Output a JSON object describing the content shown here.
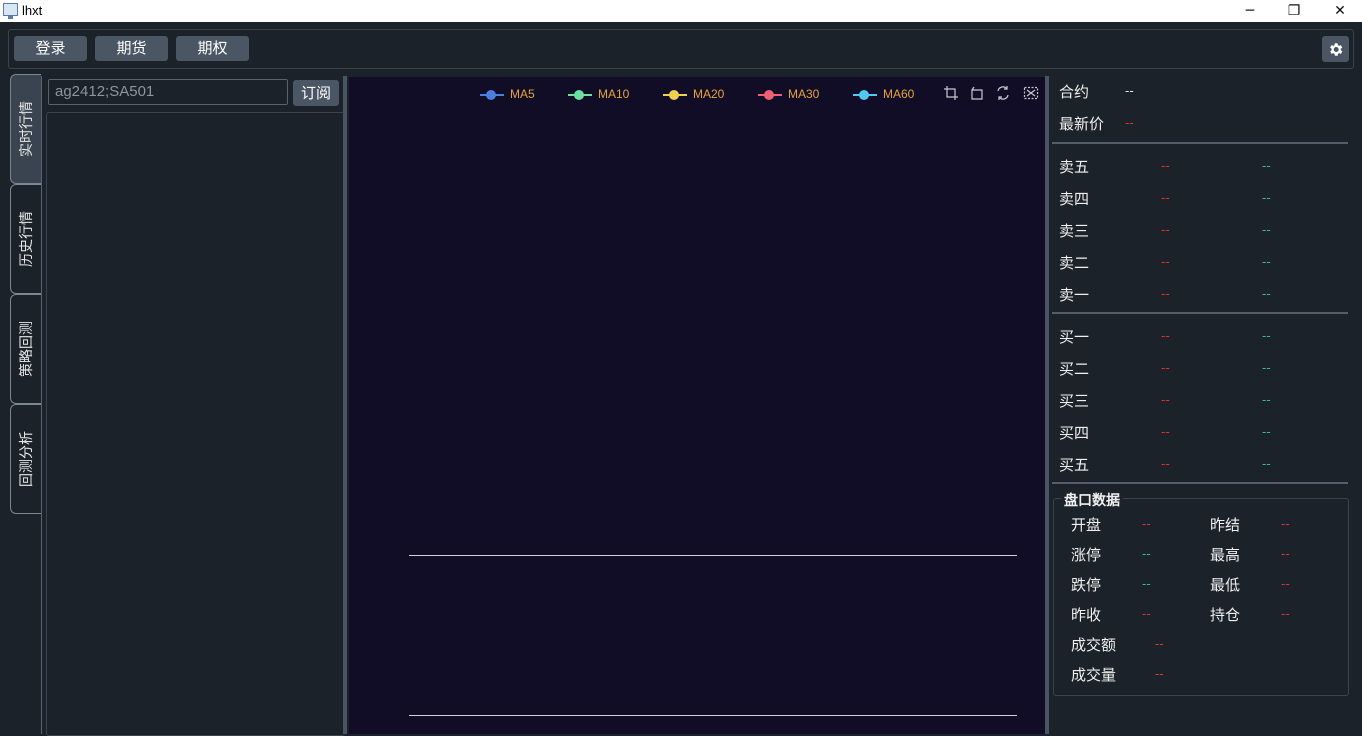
{
  "window": {
    "title": "lhxt",
    "minimize": "─",
    "maximize": "❐",
    "close": "✕"
  },
  "toolbar": {
    "login": "登录",
    "futures": "期货",
    "options": "期权"
  },
  "tabs": [
    "实时行情",
    "历史行情",
    "策略回测",
    "回测分析"
  ],
  "left": {
    "search_value": "ag2412;SA501",
    "subscribe": "订阅"
  },
  "chart": {
    "legend": [
      {
        "name": "MA5",
        "color": "#4a7fe0"
      },
      {
        "name": "MA10",
        "color": "#6be0a0"
      },
      {
        "name": "MA20",
        "color": "#f0d050"
      },
      {
        "name": "MA30",
        "color": "#f06070"
      },
      {
        "name": "MA60",
        "color": "#50c8f0"
      }
    ]
  },
  "quote": {
    "contract_label": "合约",
    "contract_value": "--",
    "last_label": "最新价",
    "last_value": "--",
    "asks": [
      {
        "label": "卖五",
        "price": "--",
        "volume": "--"
      },
      {
        "label": "卖四",
        "price": "--",
        "volume": "--"
      },
      {
        "label": "卖三",
        "price": "--",
        "volume": "--"
      },
      {
        "label": "卖二",
        "price": "--",
        "volume": "--"
      },
      {
        "label": "卖一",
        "price": "--",
        "volume": "--"
      }
    ],
    "bids": [
      {
        "label": "买一",
        "price": "--",
        "volume": "--"
      },
      {
        "label": "买二",
        "price": "--",
        "volume": "--"
      },
      {
        "label": "买三",
        "price": "--",
        "volume": "--"
      },
      {
        "label": "买四",
        "price": "--",
        "volume": "--"
      },
      {
        "label": "买五",
        "price": "--",
        "volume": "--"
      }
    ]
  },
  "market": {
    "title": "盘口数据",
    "open_label": "开盘",
    "open_value": "--",
    "prev_settle_label": "昨结",
    "prev_settle_value": "--",
    "limit_up_label": "涨停",
    "limit_up_value": "--",
    "high_label": "最高",
    "high_value": "--",
    "limit_down_label": "跌停",
    "limit_down_value": "--",
    "low_label": "最低",
    "low_value": "--",
    "prev_close_label": "昨收",
    "prev_close_value": "--",
    "open_interest_label": "持仓",
    "open_interest_value": "--",
    "turnover_label": "成交额",
    "turnover_value": "--",
    "volume_label": "成交量",
    "volume_value": "--"
  }
}
